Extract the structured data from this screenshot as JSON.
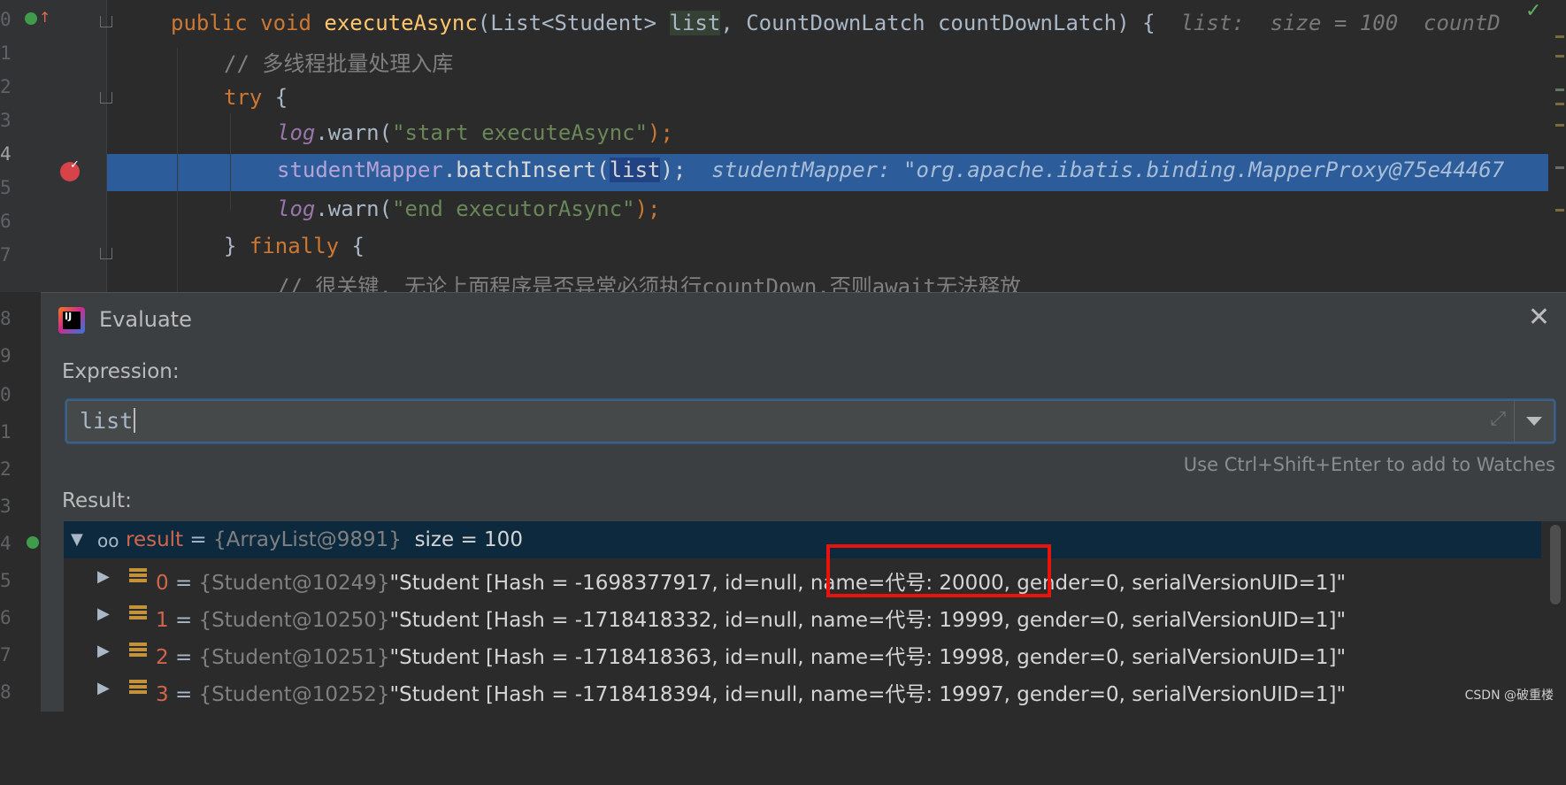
{
  "editor": {
    "line_numbers": [
      "0",
      "1",
      "2",
      "3",
      "4",
      "5",
      "6",
      "7",
      "8",
      "9",
      "0",
      "1",
      "2",
      "3",
      "4",
      "5",
      "6",
      "7",
      "8"
    ],
    "lines": {
      "l0": {
        "kw1": "public void ",
        "fn": "executeAsync",
        "p1": "(List<Student> ",
        "list": "list",
        "p2": ", CountDownLatch countDownLatch) {",
        "hint": "  list:  size = 100  countD"
      },
      "l1": {
        "comment": "// 多线程批量处理入库"
      },
      "l2": {
        "kw": "try",
        "rest": " {"
      },
      "l3": {
        "log": "log",
        "call": ".warn(",
        "str": "\"start executeAsync\"",
        "end": ");"
      },
      "l4": {
        "field": "studentMapper",
        "call": ".batchInsert(",
        "list": "list",
        "end": ");",
        "hint": "  studentMapper: \"org.apache.ibatis.binding.MapperProxy@75e44467"
      },
      "l5": {
        "log": "log",
        "call": ".warn(",
        "str": "\"end executorAsync\"",
        "end": ");"
      },
      "l6": {
        "brace": "} ",
        "kw": "finally",
        "rest": " {"
      },
      "l7": {
        "comment": "// 很关键, 无论上面程序是否异常必须执行countDown,否则await无法释放"
      }
    }
  },
  "dialog": {
    "title": "Evaluate",
    "expression_label": "Expression:",
    "expression_value": "list",
    "watch_hint": "Use Ctrl+Shift+Enter to add to Watches",
    "result_label": "Result:",
    "result": {
      "name": "result",
      "type": "{ArrayList@9891}",
      "summary": "size = 100",
      "items": [
        {
          "index": "0",
          "type": "{Student@10249}",
          "pre": "\"Student [Hash = -1698377917, id=null",
          "mid": ", name=代号: 20000,",
          "post": " gender=0, serialVersionUID=1]\""
        },
        {
          "index": "1",
          "type": "{Student@10250}",
          "pre": "\"Student [Hash = -1718418332, id=null",
          "mid": ", name=代号: 19999,",
          "post": " gender=0, serialVersionUID=1]\""
        },
        {
          "index": "2",
          "type": "{Student@10251}",
          "pre": "\"Student [Hash = -1718418363, id=null",
          "mid": ", name=代号: 19998,",
          "post": " gender=0, serialVersionUID=1]\""
        },
        {
          "index": "3",
          "type": "{Student@10252}",
          "pre": "\"Student [Hash = -1718418394, id=null",
          "mid": ", name=代号: 19997,",
          "post": " gender=0, serialVersionUID=1]\""
        }
      ]
    }
  },
  "watermark": "CSDN @破重楼",
  "colors": {
    "highlight_box": "#e8140b",
    "current_line": "#2d5c9a",
    "dialog_bg": "#3c3f41"
  }
}
